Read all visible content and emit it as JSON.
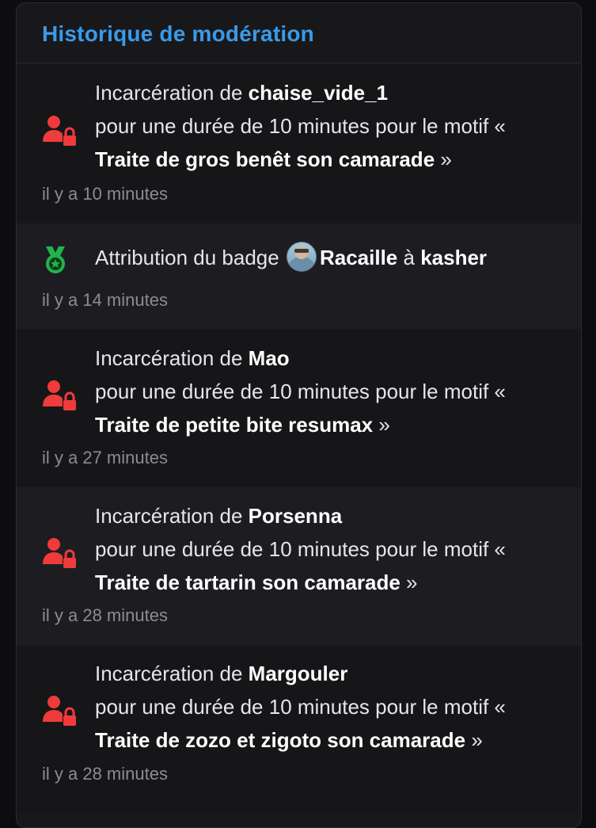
{
  "header": {
    "title": "Historique de modération"
  },
  "entries": [
    {
      "icon": "user-lock-icon",
      "line1_prefix": "Incarcération de ",
      "user": "chaise_vide_1",
      "line2": "pour une durée de 10 minutes pour le motif «",
      "reason": "Traite de gros benêt son camarade",
      "reason_suffix": " »",
      "time": "il y a 10 minutes"
    },
    {
      "icon": "badge-medal-icon",
      "prefix": "Attribution du badge ",
      "badge": "Racaille",
      "middle": " à ",
      "user": "kasher",
      "time": "il y a 14 minutes"
    },
    {
      "icon": "user-lock-icon",
      "line1_prefix": "Incarcération de ",
      "user": "Mao",
      "line2": "pour une durée de 10 minutes pour le motif «",
      "reason": "Traite de petite bite resumax",
      "reason_suffix": " »",
      "time": "il y a 27 minutes"
    },
    {
      "icon": "user-lock-icon",
      "line1_prefix": "Incarcération de ",
      "user": "Porsenna",
      "line2": "pour une durée de 10 minutes pour le motif «",
      "reason": "Traite de tartarin son camarade",
      "reason_suffix": " »",
      "time": "il y a 28 minutes"
    },
    {
      "icon": "user-lock-icon",
      "line1_prefix": "Incarcération de ",
      "user": "Margouler",
      "line2": "pour une durée de 10 minutes pour le motif «",
      "reason": "Traite de zozo et zigoto son camarade",
      "reason_suffix": " »",
      "time": "il y a 28 minutes"
    }
  ],
  "colors": {
    "title": "#3b9ae8",
    "jail_icon": "#ef3b3b",
    "badge_icon": "#22b34a",
    "timestamp": "#8b8b93"
  }
}
